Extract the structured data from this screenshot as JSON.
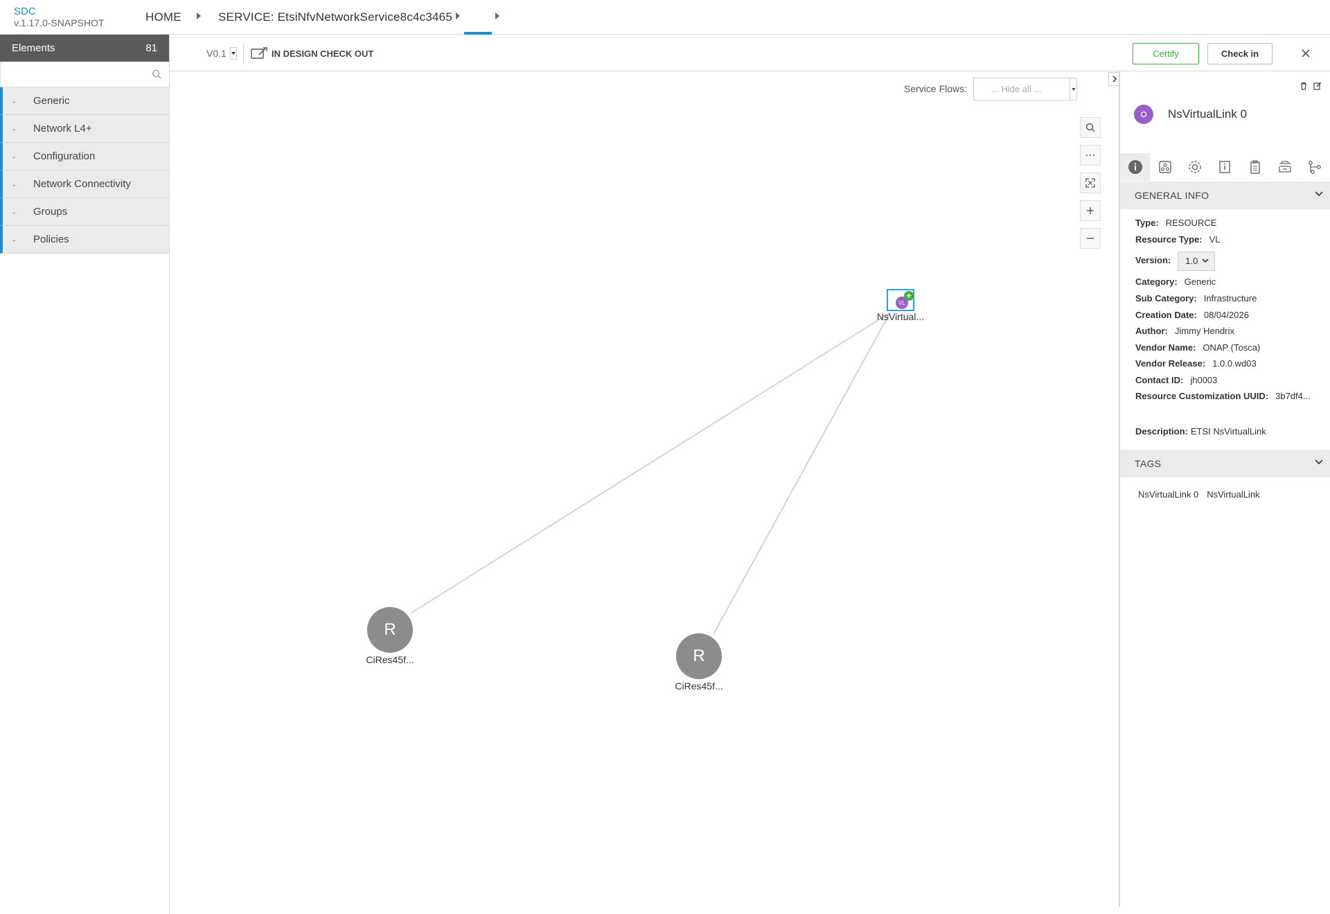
{
  "header": {
    "brand": "SDC",
    "version": "v.1.17.0-SNAPSHOT",
    "breadcrumbs": [
      "HOME",
      "SERVICE: EtsiNfvNetworkService8c4c3465",
      ""
    ]
  },
  "palette": {
    "title": "Elements",
    "count": "81",
    "search_placeholder": "",
    "items": [
      {
        "dash": "-",
        "label": "Generic"
      },
      {
        "dash": "-",
        "label": "Network L4+"
      },
      {
        "dash": "-",
        "label": "Configuration"
      },
      {
        "dash": "-",
        "label": "Network Connectivity"
      },
      {
        "dash": "-",
        "label": "Groups"
      },
      {
        "dash": "-",
        "label": "Policies"
      }
    ]
  },
  "toolbar": {
    "version": "V0.1",
    "state": "IN DESIGN CHECK OUT",
    "certify_label": "Certify",
    "checkin_label": "Check in"
  },
  "canvas": {
    "service_flows_label": "Service Flows:",
    "service_flows_value": "... Hide all ...",
    "nodes": [
      {
        "id": "vl",
        "letter": "VL",
        "label": "NsVirtual..."
      },
      {
        "id": "r1",
        "letter": "R",
        "label": "CiRes45f..."
      },
      {
        "id": "r2",
        "letter": "R",
        "label": "CiRes45f..."
      }
    ]
  },
  "panel": {
    "title": "NsVirtualLink 0",
    "general_info_title": "GENERAL INFO",
    "info": [
      {
        "k": "Type:",
        "v": "RESOURCE"
      },
      {
        "k": "Resource Type:",
        "v": "VL"
      },
      {
        "k": "Version:",
        "v": "1.0"
      },
      {
        "k": "Category:",
        "v": "Generic"
      },
      {
        "k": "Sub Category:",
        "v": "Infrastructure"
      },
      {
        "k": "Creation Date:",
        "v": "08/04/2026"
      },
      {
        "k": "Author:",
        "v": "Jimmy Hendrix"
      },
      {
        "k": "Vendor Name:",
        "v": "ONAP (Tosca)"
      },
      {
        "k": "Vendor Release:",
        "v": "1.0.0.wd03"
      },
      {
        "k": "Contact ID:",
        "v": "jh0003"
      },
      {
        "k": "Resource Customization UUID:",
        "v": "3b7df4..."
      }
    ],
    "description_label": "Description:",
    "description": "ETSI NsVirtualLink",
    "tags_title": "TAGS",
    "tags": [
      "NsVirtualLink 0",
      "NsVirtualLink"
    ]
  },
  "colors": {
    "accent": "#1a8fc9",
    "certify": "#3bb034",
    "vl_node": "#9c5ec9",
    "resource_node": "#8c8c8c"
  }
}
